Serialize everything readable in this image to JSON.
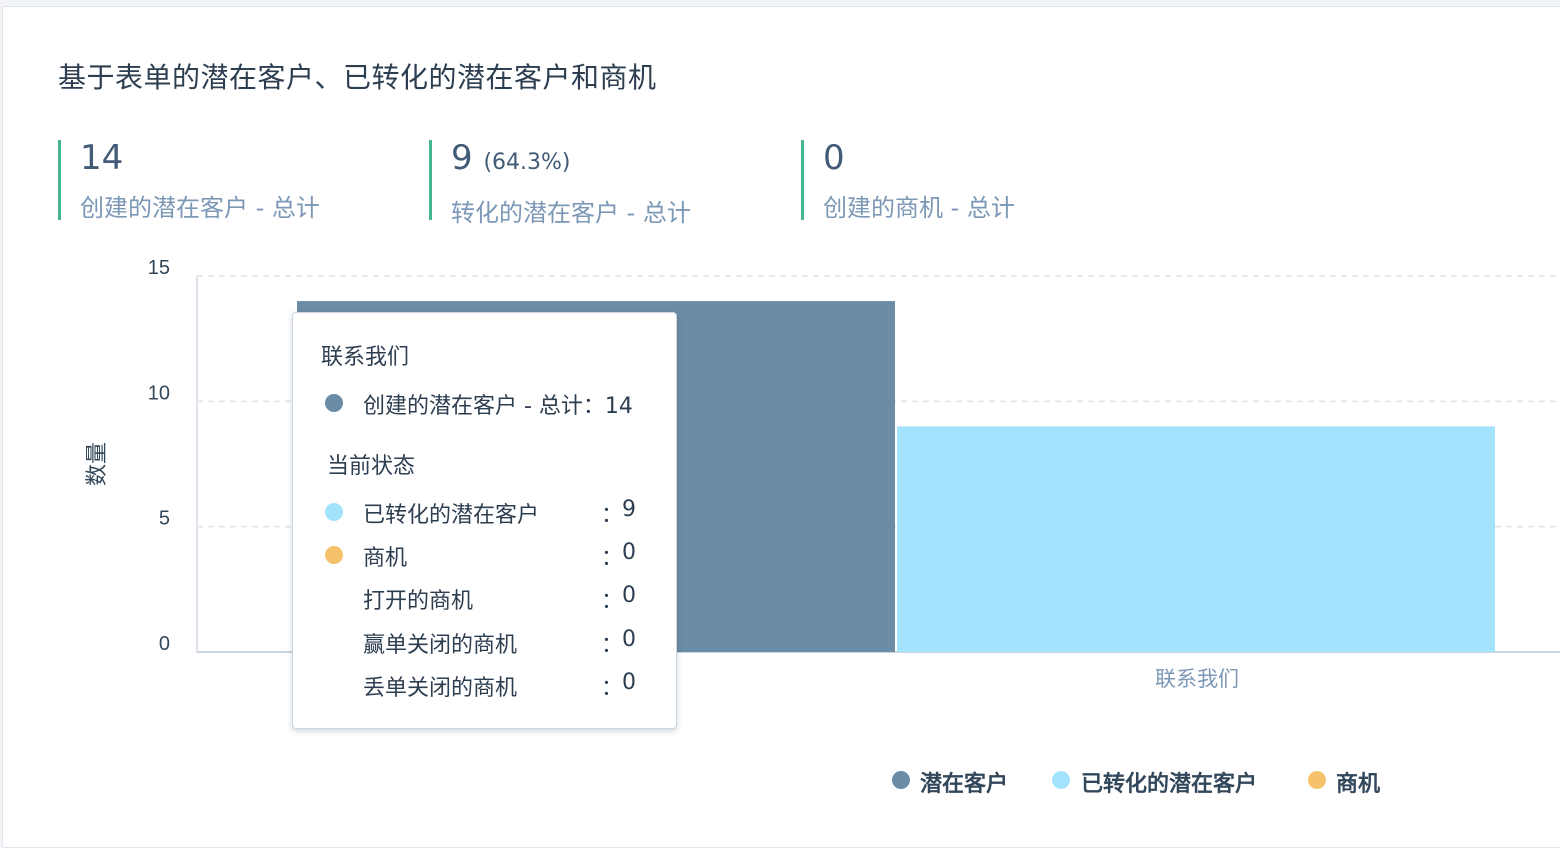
{
  "title": "基于表单的潜在客户、已转化的潜在客户和商机",
  "kpis": [
    {
      "value": "14",
      "pct": "",
      "label": "创建的潜在客户 - 总计"
    },
    {
      "value": "9",
      "pct": "(64.3%)",
      "label": "转化的潜在客户 - 总计"
    },
    {
      "value": "0",
      "pct": "",
      "label": "创建的商机 - 总计"
    }
  ],
  "colors": {
    "accent": "#46b58f",
    "leads": "#6b8ca6",
    "converted": "#a4e3fd",
    "deals": "#f5c26b"
  },
  "chart_data": {
    "type": "bar",
    "ylabel": "数量",
    "ylim": [
      0,
      15
    ],
    "yticks": [
      "0",
      "5",
      "10",
      "15"
    ],
    "categories": [
      "联系我们"
    ],
    "series": [
      {
        "name": "潜在客户",
        "values": [
          14
        ],
        "color": "#6b8ca6"
      },
      {
        "name": "已转化的潜在客户",
        "values": [
          9
        ],
        "color": "#a4e3fd"
      },
      {
        "name": "商机",
        "values": [
          0
        ],
        "color": "#f5c26b"
      }
    ],
    "grid": true,
    "legend": "bottom-right"
  },
  "tooltip": {
    "title": "联系我们",
    "total_label": "创建的潜在客户 - 总计：14",
    "section": "当前状态",
    "rows": [
      {
        "label": "已转化的潜在客户",
        "value": "9"
      },
      {
        "label": "商机",
        "value": "0"
      },
      {
        "label": "打开的商机",
        "value": "0"
      },
      {
        "label": "赢单关闭的商机",
        "value": "0"
      },
      {
        "label": "丢单关闭的商机",
        "value": "0"
      }
    ],
    "separator": "："
  }
}
